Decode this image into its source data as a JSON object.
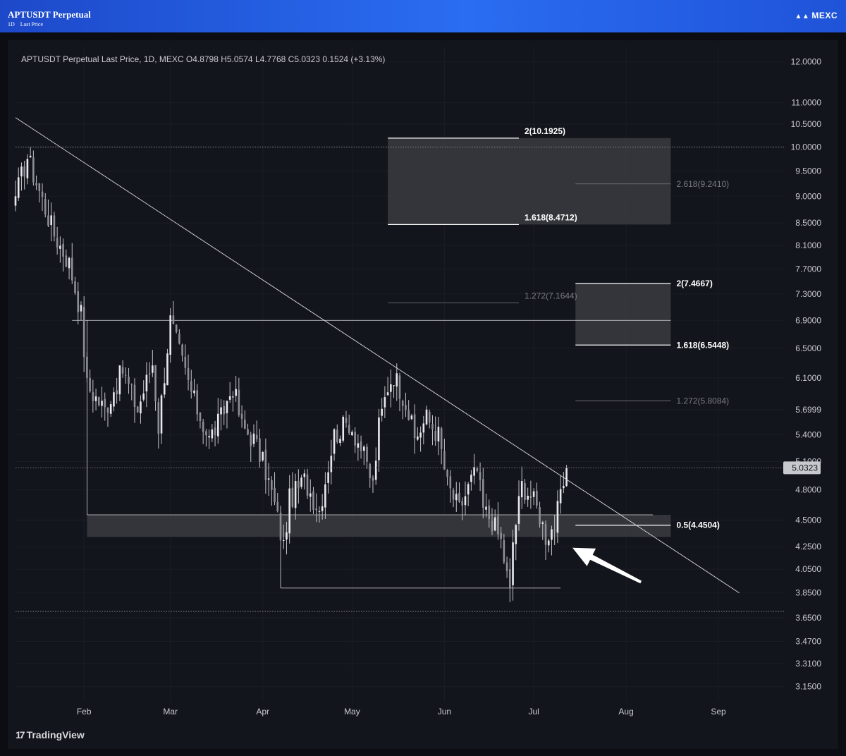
{
  "header": {
    "title": "APTUSDT Perpetual",
    "timeframe": "1D",
    "price_type": "Last Price",
    "brand": "MEXC",
    "brand_icon": "mexc-logo-icon"
  },
  "footer": {
    "brand": "TradingView",
    "icon": "tradingview-logo-icon"
  },
  "colors": {
    "background": "#13151c",
    "candle": "#c4c4c8",
    "fib_strong": "#ffffff",
    "fib_faint": "#7a7b82",
    "zone": "#3a3b41"
  },
  "chart_data": {
    "type": "candlestick",
    "legend": {
      "symbol": "APTUSDT Perpetual Last Price, 1D, MEXC",
      "open": "O4.8798",
      "high": "H5.0574",
      "low": "L4.7768",
      "close": "C5.0323",
      "change": "0.1524 (+3.13%)"
    },
    "y_scale": "log",
    "ylim": [
      3.05,
      12.4
    ],
    "y_ticks": [
      "12.0000",
      "11.0000",
      "10.5000",
      "10.0000",
      "9.5000",
      "9.0000",
      "8.5000",
      "8.1000",
      "7.7000",
      "7.3000",
      "6.9000",
      "6.5000",
      "6.1000",
      "5.6999",
      "5.4000",
      "5.1000",
      "4.8000",
      "4.5000",
      "4.2500",
      "4.0500",
      "3.8500",
      "3.6500",
      "3.4700",
      "3.3100",
      "3.1500"
    ],
    "last_price": "5.0323",
    "x_ticks": [
      {
        "label": "Feb",
        "date": "2024-02-01"
      },
      {
        "label": "Mar",
        "date": "2024-03-01"
      },
      {
        "label": "Apr",
        "date": "2024-04-01"
      },
      {
        "label": "May",
        "date": "2024-05-01"
      },
      {
        "label": "Jun",
        "date": "2024-06-01"
      },
      {
        "label": "Jul",
        "date": "2024-07-01"
      },
      {
        "label": "Aug",
        "date": "2024-08-01"
      },
      {
        "label": "Sep",
        "date": "2024-09-01"
      }
    ],
    "x_start": "2024-01-09",
    "x_end": "2024-09-23",
    "swing_points": [
      {
        "date": "2024-01-09",
        "price": 9.0
      },
      {
        "date": "2024-01-13",
        "price": 9.8
      },
      {
        "date": "2024-01-17",
        "price": 9.1
      },
      {
        "date": "2024-01-22",
        "price": 8.3
      },
      {
        "date": "2024-01-27",
        "price": 7.8
      },
      {
        "date": "2024-01-31",
        "price": 7.0
      },
      {
        "date": "2024-02-02",
        "price": 6.0
      },
      {
        "date": "2024-02-08",
        "price": 5.7
      },
      {
        "date": "2024-02-14",
        "price": 6.2
      },
      {
        "date": "2024-02-19",
        "price": 5.7
      },
      {
        "date": "2024-02-24",
        "price": 6.3
      },
      {
        "date": "2024-02-26",
        "price": 5.5
      },
      {
        "date": "2024-03-01",
        "price": 6.9
      },
      {
        "date": "2024-03-05",
        "price": 6.3
      },
      {
        "date": "2024-03-09",
        "price": 5.8
      },
      {
        "date": "2024-03-14",
        "price": 5.35
      },
      {
        "date": "2024-03-18",
        "price": 5.6
      },
      {
        "date": "2024-03-22",
        "price": 6.0
      },
      {
        "date": "2024-03-25",
        "price": 5.5
      },
      {
        "date": "2024-03-29",
        "price": 5.35
      },
      {
        "date": "2024-04-02",
        "price": 5.0
      },
      {
        "date": "2024-04-05",
        "price": 4.65
      },
      {
        "date": "2024-04-08",
        "price": 4.25
      },
      {
        "date": "2024-04-10",
        "price": 4.7
      },
      {
        "date": "2024-04-15",
        "price": 4.9
      },
      {
        "date": "2024-04-20",
        "price": 4.6
      },
      {
        "date": "2024-04-25",
        "price": 5.4
      },
      {
        "date": "2024-04-30",
        "price": 5.55
      },
      {
        "date": "2024-05-04",
        "price": 5.25
      },
      {
        "date": "2024-05-08",
        "price": 4.85
      },
      {
        "date": "2024-05-10",
        "price": 5.5
      },
      {
        "date": "2024-05-13",
        "price": 6.0
      },
      {
        "date": "2024-05-15",
        "price": 6.15
      },
      {
        "date": "2024-05-19",
        "price": 5.8
      },
      {
        "date": "2024-05-22",
        "price": 5.35
      },
      {
        "date": "2024-05-26",
        "price": 5.6
      },
      {
        "date": "2024-05-30",
        "price": 5.4
      },
      {
        "date": "2024-06-02",
        "price": 4.85
      },
      {
        "date": "2024-06-06",
        "price": 4.6
      },
      {
        "date": "2024-06-10",
        "price": 4.9
      },
      {
        "date": "2024-06-12",
        "price": 5.0
      },
      {
        "date": "2024-06-14",
        "price": 4.6
      },
      {
        "date": "2024-06-17",
        "price": 4.5
      },
      {
        "date": "2024-06-20",
        "price": 4.3
      },
      {
        "date": "2024-06-23",
        "price": 3.85
      },
      {
        "date": "2024-06-24",
        "price": 4.3
      },
      {
        "date": "2024-06-27",
        "price": 4.85
      },
      {
        "date": "2024-06-30",
        "price": 4.75
      },
      {
        "date": "2024-07-03",
        "price": 4.55
      },
      {
        "date": "2024-07-05",
        "price": 4.35
      },
      {
        "date": "2024-07-08",
        "price": 4.45
      },
      {
        "date": "2024-07-11",
        "price": 4.85
      },
      {
        "date": "2024-07-12",
        "price": 5.0323
      }
    ],
    "trendline": {
      "from": {
        "date": "2024-01-09",
        "price": 10.65
      },
      "to": {
        "date": "2024-09-08",
        "price": 3.85
      }
    },
    "horizontal_lines": [
      {
        "price": 10.0,
        "style": "dotted"
      },
      {
        "price": 6.9,
        "from": "2024-01-28",
        "to": "2024-08-16"
      },
      {
        "price": 4.5504,
        "from": "2024-02-02",
        "to": "2024-08-10"
      },
      {
        "price": 3.89,
        "from": "2024-04-07",
        "to": "2024-07-10"
      },
      {
        "price": 3.7,
        "style": "dotted"
      }
    ],
    "vertical_lines": [
      {
        "date": "2024-02-02",
        "from": 4.5504,
        "to": 6.9
      },
      {
        "date": "2024-04-07",
        "from": 3.89,
        "to": 4.5504
      }
    ],
    "zones": [
      {
        "from": "2024-05-13",
        "to": "2024-08-16",
        "low": 8.4712,
        "high": 10.1925
      },
      {
        "from": "2024-07-15",
        "to": "2024-08-16",
        "low": 6.5448,
        "high": 7.4667
      },
      {
        "from": "2024-02-02",
        "to": "2024-08-16",
        "low": 4.34,
        "high": 4.5504
      }
    ],
    "fib_levels": [
      {
        "label": "2(10.1925)",
        "price": 10.1925,
        "from": "2024-05-13",
        "to": "2024-06-26",
        "strong": true,
        "label_pos": "above-end"
      },
      {
        "label": "2.618(9.2410)",
        "price": 9.241,
        "from": "2024-07-15",
        "to": "2024-08-16",
        "strong": false,
        "label_pos": "right"
      },
      {
        "label": "1.618(8.4712)",
        "price": 8.4712,
        "from": "2024-05-13",
        "to": "2024-06-26",
        "strong": true,
        "label_pos": "above-end"
      },
      {
        "label": "1.272(7.1644)",
        "price": 7.1644,
        "from": "2024-05-13",
        "to": "2024-06-26",
        "strong": false,
        "label_pos": "above-end"
      },
      {
        "label": "2(7.4667)",
        "price": 7.4667,
        "from": "2024-07-15",
        "to": "2024-08-16",
        "strong": true,
        "label_pos": "right"
      },
      {
        "label": "1.618(6.5448)",
        "price": 6.5448,
        "from": "2024-07-15",
        "to": "2024-08-16",
        "strong": true,
        "label_pos": "right"
      },
      {
        "label": "1.272(5.8084)",
        "price": 5.8084,
        "from": "2024-07-15",
        "to": "2024-08-16",
        "strong": false,
        "label_pos": "right"
      },
      {
        "label": "0.5(4.4504)",
        "price": 4.4504,
        "from": "2024-07-15",
        "to": "2024-08-16",
        "strong": true,
        "label_pos": "right"
      }
    ],
    "arrow": {
      "tail": {
        "date": "2024-08-06",
        "price": 3.94
      },
      "head": {
        "date": "2024-07-14",
        "price": 4.24
      }
    }
  }
}
